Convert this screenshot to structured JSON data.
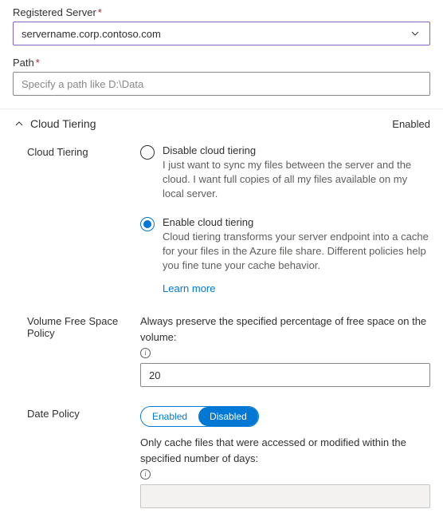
{
  "registered_server": {
    "label": "Registered Server",
    "value": "servername.corp.contoso.com"
  },
  "path": {
    "label": "Path",
    "placeholder": "Specify a path like D:\\Data",
    "value": ""
  },
  "section": {
    "title": "Cloud Tiering",
    "status": "Enabled"
  },
  "cloud_tiering": {
    "label": "Cloud Tiering",
    "disable": {
      "title": "Disable cloud tiering",
      "desc": "I just want to sync my files between the server and the cloud. I want full copies of all my files available on my local server."
    },
    "enable": {
      "title": "Enable cloud tiering",
      "desc": "Cloud tiering transforms your server endpoint into a cache for your files in the Azure file share. Different policies help you fine tune your cache behavior."
    },
    "learn_more": "Learn more"
  },
  "volume_policy": {
    "label": "Volume Free Space Policy",
    "desc": "Always preserve the specified percentage of free space on the volume:",
    "value": "20"
  },
  "date_policy": {
    "label": "Date Policy",
    "toggle": {
      "enabled": "Enabled",
      "disabled": "Disabled"
    },
    "desc": "Only cache files that were accessed or modified within the specified number of days:",
    "value": ""
  }
}
